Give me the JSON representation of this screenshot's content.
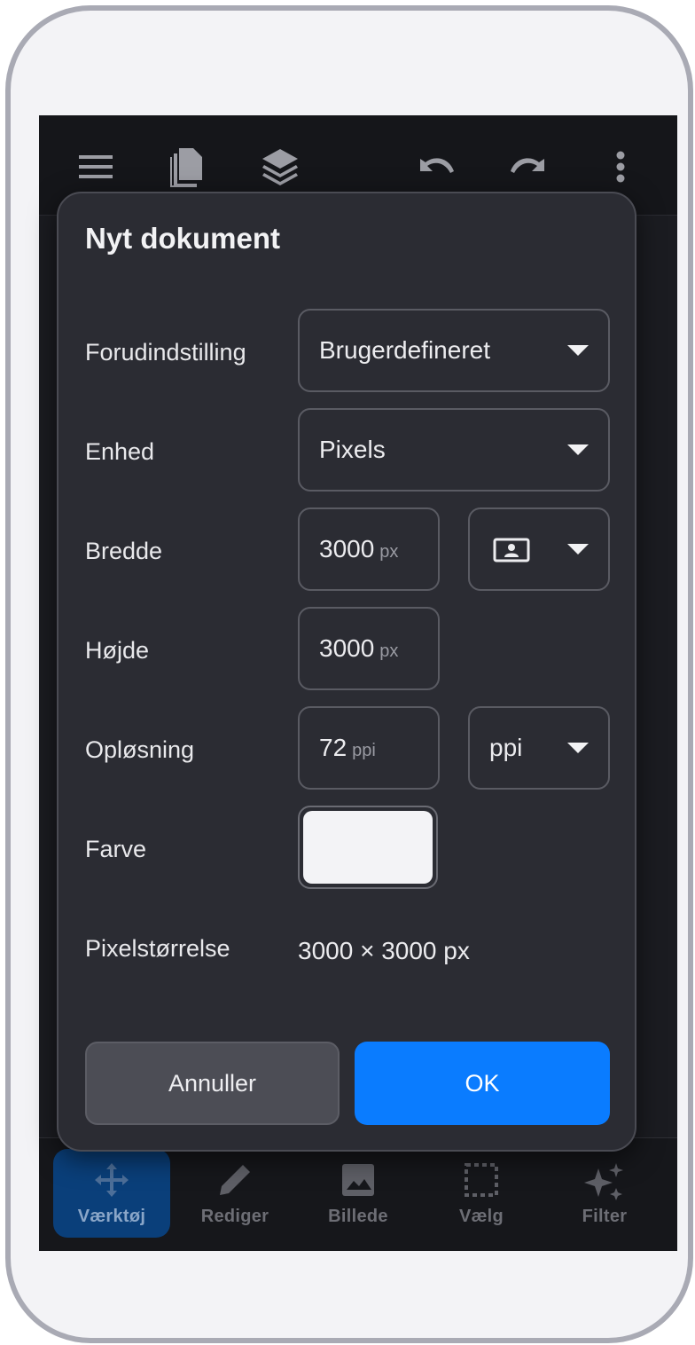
{
  "app": {
    "nav": [
      {
        "label": "Værktøj",
        "icon": "move-icon",
        "active": true
      },
      {
        "label": "Rediger",
        "icon": "pencil-icon",
        "active": false
      },
      {
        "label": "Billede",
        "icon": "image-icon",
        "active": false
      },
      {
        "label": "Vælg",
        "icon": "selection-icon",
        "active": false
      },
      {
        "label": "Filter",
        "icon": "sparkle-icon",
        "active": false
      }
    ],
    "topbar_icons": [
      "menu-icon",
      "documents-icon",
      "layers-icon",
      "undo-icon",
      "redo-icon",
      "more-vertical-icon"
    ]
  },
  "dialog": {
    "title": "Nyt dokument",
    "preset": {
      "label": "Forudindstilling",
      "value": "Brugerdefineret"
    },
    "unit": {
      "label": "Enhed",
      "value": "Pixels"
    },
    "width": {
      "label": "Bredde",
      "value": "3000",
      "unit": "px",
      "orientation_icon": "portrait-orientation-icon"
    },
    "height": {
      "label": "Højde",
      "value": "3000",
      "unit": "px"
    },
    "resolution": {
      "label": "Opløsning",
      "value": "72",
      "unit": "ppi",
      "unit_select": "ppi"
    },
    "color": {
      "label": "Farve",
      "value": "#f3f3f6"
    },
    "pixel_size": {
      "label": "Pixelstørrelse",
      "value": "3000 × 3000 px"
    },
    "cancel_label": "Annuller",
    "ok_label": "OK"
  },
  "colors": {
    "accent": "#0a7cff",
    "dialog_bg": "#2b2c33",
    "active_nav": "#0a3f7a"
  }
}
